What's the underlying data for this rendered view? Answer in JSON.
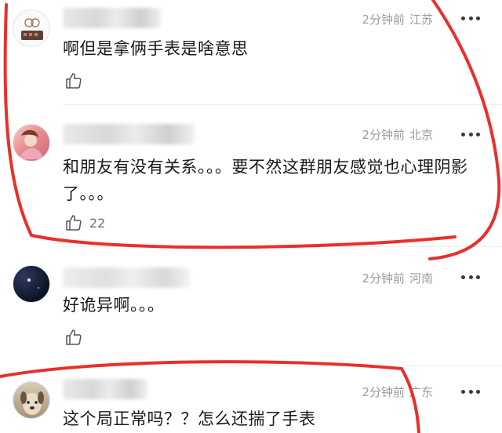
{
  "comments": [
    {
      "time": "2分钟前",
      "location": "江苏",
      "text": "啊但是拿俩手表是啥意思",
      "likes": ""
    },
    {
      "time": "2分钟前",
      "location": "北京",
      "text": "和朋友有没有关系。。。要不然这群朋友感觉也心理阴影了。。。",
      "likes": "22"
    },
    {
      "time": "2分钟前",
      "location": "河南",
      "text": "好诡异啊。。。",
      "likes": ""
    },
    {
      "time": "2分钟前",
      "location": "广东",
      "text": "这个局正常吗？？怎么还揣了手表",
      "likes": ""
    }
  ],
  "colors": {
    "annotation": "#e8302a",
    "meta": "#9b9b9b",
    "text": "#1a1a1a"
  },
  "icons": [
    "thumbs-up-icon",
    "more-dots-icon"
  ]
}
